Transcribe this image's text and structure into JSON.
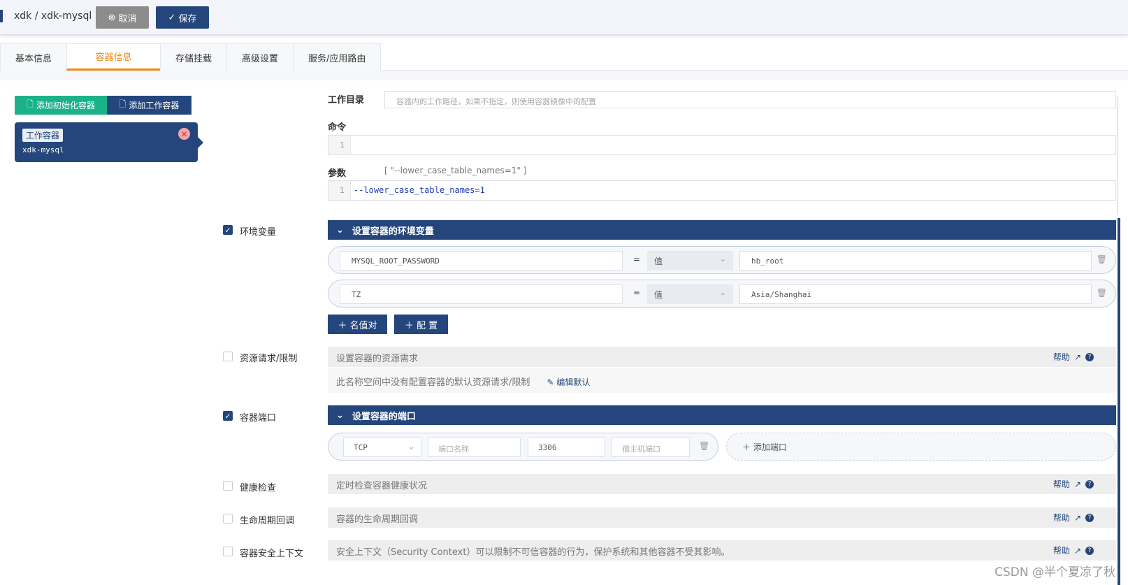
{
  "header": {
    "breadcrumb": "xdk / xdk-mysql",
    "cancel_label": "取消",
    "save_label": "保存"
  },
  "tabs": [
    {
      "label": "基本信息"
    },
    {
      "label": "容器信息"
    },
    {
      "label": "存储挂载"
    },
    {
      "label": "高级设置"
    },
    {
      "label": "服务/应用路由"
    }
  ],
  "left": {
    "add_init_label": "添加初始化容器",
    "add_work_label": "添加工作容器",
    "container_tag": "工作容器",
    "container_name": "xdk-mysql"
  },
  "form": {
    "workdir_label": "工作目录",
    "workdir_placeholder": "容器内的工作路径，如果不指定，则使用容器镜像中的配置",
    "command_label": "命令",
    "command_line": "1",
    "args_label": "参数",
    "args_hint": "[ \"--lower_case_table_names=1\" ]",
    "args_line": "1",
    "args_code": "--lower_case_table_names=1"
  },
  "env": {
    "label": "环境变量",
    "section_title": "设置容器的环境变量",
    "rows": [
      {
        "key": "MYSQL_ROOT_PASSWORD",
        "eq": "=",
        "type": "值",
        "value": "hb_root"
      },
      {
        "key": "TZ",
        "eq": "=",
        "type": "值",
        "value": "Asia/Shanghai"
      }
    ],
    "add_pair_label": "名值对",
    "add_config_label": "配 置"
  },
  "resources": {
    "label": "资源请求/限制",
    "bar_text": "设置容器的资源需求",
    "note": "此名称空间中没有配置容器的默认资源请求/限制",
    "edit_label": "编辑默认",
    "help": "帮助"
  },
  "ports": {
    "label": "容器端口",
    "section_title": "设置容器的端口",
    "protocol": "TCP",
    "name_placeholder": "端口名称",
    "port": "3306",
    "host_placeholder": "宿主机端口",
    "add_label": "添加端口"
  },
  "health": {
    "label": "健康检查",
    "bar_text": "定时检查容器健康状况",
    "help": "帮助"
  },
  "lifecycle": {
    "label": "生命周期回调",
    "bar_text": "容器的生命周期回调",
    "help": "帮助"
  },
  "security": {
    "label": "容器安全上下文",
    "bar_text": "安全上下文（Security Context）可以限制不可信容器的行为，保护系统和其他容器不受其影响。",
    "help": "帮助"
  },
  "watermark": "CSDN @半个夏凉了秋"
}
